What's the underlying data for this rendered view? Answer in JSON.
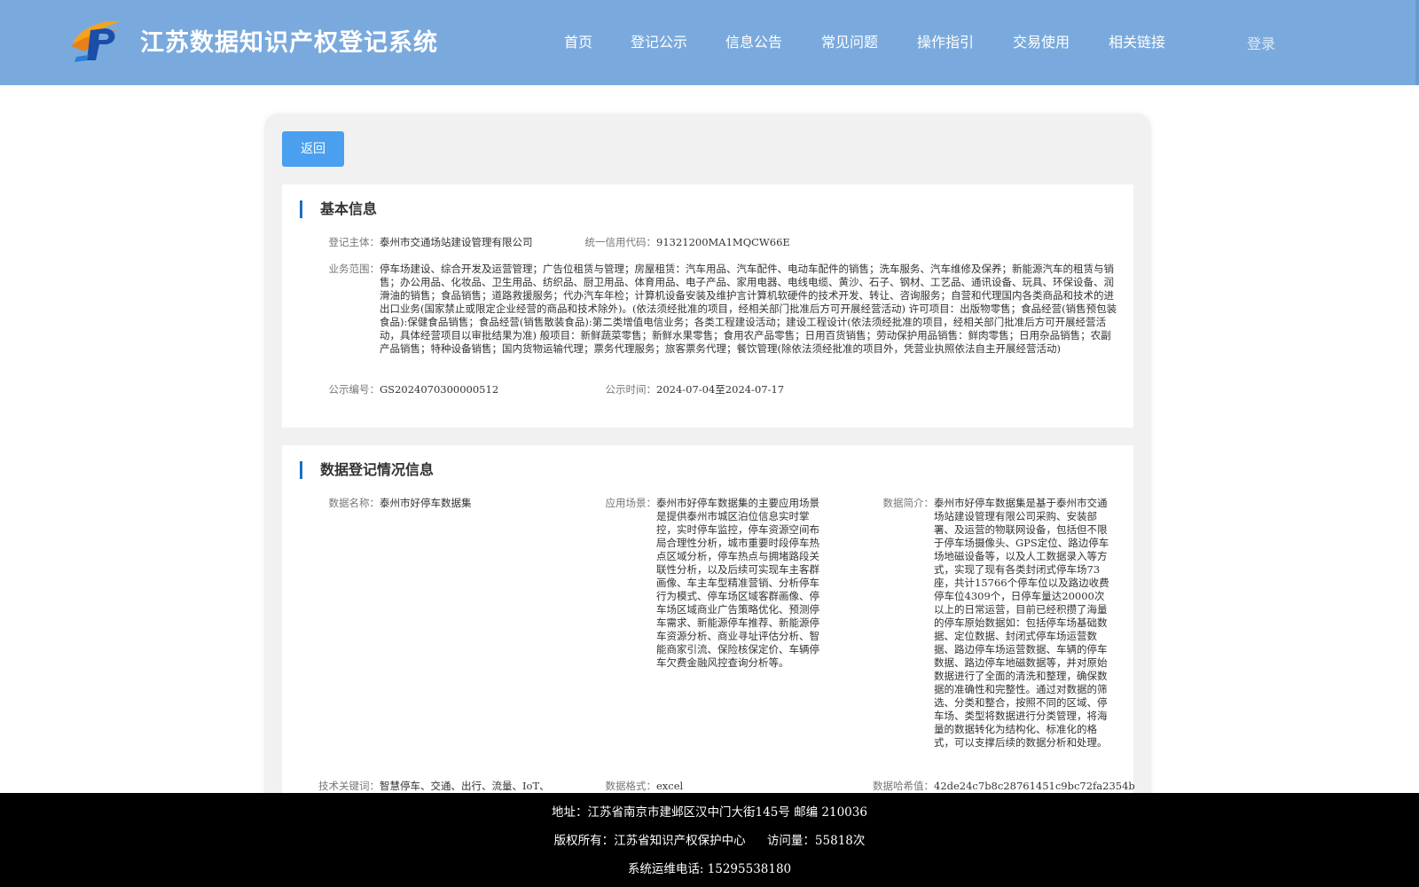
{
  "header": {
    "title": "江苏数据知识产权登记系统",
    "nav": [
      "首页",
      "登记公示",
      "信息公告",
      "常见问题",
      "操作指引",
      "交易使用",
      "相关链接"
    ],
    "login_label": "登录",
    "bg_color": "#7aaadd"
  },
  "main": {
    "back_label": "返回",
    "basic": {
      "title": "基本信息",
      "subject_label": "登记主体：",
      "subject": "泰州市交通场站建设管理有限公司",
      "credit_label": "统一信用代码：",
      "credit": "91321200MA1MQCW66E",
      "scope_label": "业务范围：",
      "scope": "停车场建设、综合开发及运营管理；广告位租赁与管理；房屋租赁：汽车用品、汽车配件、电动车配件的销售；洗车服务、汽车维修及保养；新能源汽车的租赁与销售；办公用品、化妆品、卫生用品、纺织品、厨卫用品、体育用品、电子产品、家用电器、电线电缆、黄沙、石子、钢材、工艺品、通讯设备、玩具、环保设备、润滑油的销售；食品销售；道路救援服务；代办汽车年检；计算机设备安装及维护言计算机软硬件的技术开发、转让、咨询服务；自营和代理国内各类商品和技术的进出口业务(国家禁止或限定企业经营的商品和技术除外)。(依法须经批准的项目，经相关部门批准后方可开展经营活动) 许可项目：出版物零售；食品经营(销售预包装食品):保健食品销售；食品经营(销售散装食品):第二类增值电信业务；各类工程建设活动；建设工程设计(依法须经批准的项目，经相关部门批准后方可开展经营活动，具体经营项目以审批结果为准) 般项目：新鲜蔬菜零售；新鲜水果零售；食用农产品零售；日用百货销售；劳动保护用品销售：鲜肉零售；日用杂品销售；农副产品销售；特种设备销售；国内货物运输代理；票务代理服务；旅客票务代理；餐饮管理(除依法须经批准的项目外，凭营业执照依法自主开展经营活动)",
      "notice_no_label": "公示编号：",
      "notice_no": "GS2024070300000512",
      "notice_time_label": "公示时间：",
      "notice_time": "2024-07-04至2024-07-17"
    },
    "registration": {
      "title": "数据登记情况信息",
      "name_label": "数据名称：",
      "name": "泰州市好停车数据集",
      "scene_label": "应用场景：",
      "scene": "泰州市好停车数据集的主要应用场景是提供泰州市城区泊位信息实时掌控，实时停车监控，停车资源空间布局合理性分析，城市重要时段停车热点区域分析，停车热点与拥堵路段关联性分析，以及后续可实现车主客群画像、车主车型精准营销、分析停车行为模式、停车场区域客群画像、停车场区域商业广告策略优化、预测停车需求、新能源停车推荐、新能源停车资源分析、商业寻址评估分析、智能商家引流、保险核保定价、车辆停车欠费金融风控查询分析等。",
      "intro_label": "数据简介：",
      "intro": "泰州市好停车数据集是基于泰州市交通场站建设管理有限公司采购、安装部署、及运营的物联网设备，包括但不限于停车场摄像头、GPS定位、路边停车场地磁设备等，以及人工数据录入等方式，实现了现有各类封闭式停车场73座，共计15766个停车位以及路边收费停车位4309个，日停车量达20000次以上的日常运营，目前已经积攒了海量的停车原始数据如：包括停车场基础数据、定位数据、封闭式停车场运营数据、路边停车场运营数据、车辆的停车数据、路边停车地磁数据等，并对原始数据进行了全面的清洗和整理，确保数据的准确性和完整性。通过对数据的筛选、分类和整合，按照不同的区域、停车场、类型将数据进行分类管理，将海量的数据转化为结构化、标准化的格式，可以支撑后续的数据分析和处理。",
      "keywords_label": "技术关键词：",
      "keywords": "智慧停车、交通、出行、流量、IoT、",
      "format_label": "数据格式：",
      "format": "excel",
      "hash_label": "数据哈希值：",
      "hash": "42de24c7b8c28761451c9bc72fa2354b"
    }
  },
  "footer": {
    "address": "地址：江苏省南京市建邺区汉中门大街145号 邮编 210036",
    "copyright": "版权所有：江苏省知识产权保护中心",
    "visits": "访问量：55818次",
    "phone": "系统运维电话: 15295538180"
  }
}
